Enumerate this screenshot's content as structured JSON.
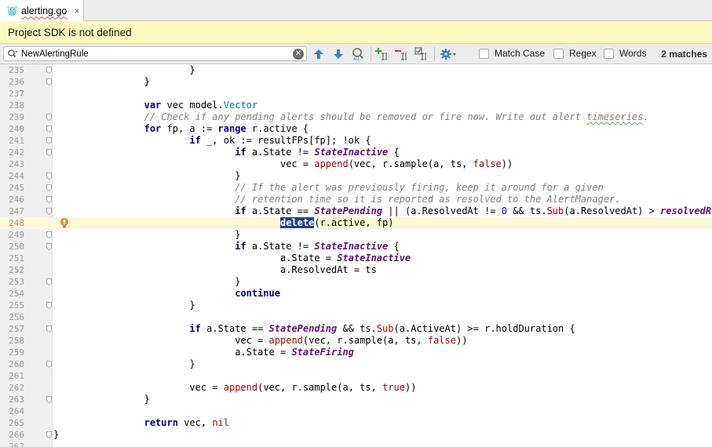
{
  "tab": {
    "filename": "alerting.go",
    "close_glyph": "×"
  },
  "banner": {
    "message": "Project SDK is not defined"
  },
  "search": {
    "query": "NewAlertingRule",
    "options": [
      {
        "label": "Match Case",
        "checked": false
      },
      {
        "label": "Regex",
        "checked": false
      },
      {
        "label": "Words",
        "checked": false
      }
    ],
    "match_count": "2 matches",
    "toolbar_icons": [
      "previous-occurrence-icon",
      "next-occurrence-icon",
      "find-all-icon",
      "add-occurrence-icon",
      "remove-occurrence-icon",
      "select-all-occurrences-icon",
      "settings-icon"
    ]
  },
  "colors": {
    "keyword": "#000080",
    "type": "#008080",
    "constant": "#660e7a",
    "builtin_function": "#aa0000",
    "number": "#0000ff",
    "comment": "#808080",
    "current_line": "#fcf8d8",
    "banner": "#fdf7c0",
    "selection": "#214283"
  },
  "editor": {
    "current_line": 248,
    "lines": [
      {
        "n": "235",
        "fold": true,
        "tokens": [
          {
            "t": "\t\t\t}",
            "c": ""
          }
        ]
      },
      {
        "n": "236",
        "fold": true,
        "tokens": [
          {
            "t": "\t\t}",
            "c": ""
          }
        ]
      },
      {
        "n": "237",
        "fold": false,
        "tokens": []
      },
      {
        "n": "238",
        "fold": false,
        "tokens": [
          {
            "t": "\t\t",
            "c": ""
          },
          {
            "t": "var",
            "c": "kw"
          },
          {
            "t": " vec model.",
            "c": ""
          },
          {
            "t": "Vector",
            "c": "typ"
          }
        ]
      },
      {
        "n": "239",
        "fold": true,
        "tokens": [
          {
            "t": "\t\t",
            "c": ""
          },
          {
            "t": "// Check if any pending alerts should be removed or fire now. Write out alert ",
            "c": "cmt"
          },
          {
            "t": "timeseries",
            "c": "cmt typo"
          },
          {
            "t": ".",
            "c": "cmt"
          }
        ]
      },
      {
        "n": "240",
        "fold": true,
        "tokens": [
          {
            "t": "\t\t",
            "c": ""
          },
          {
            "t": "for",
            "c": "kw"
          },
          {
            "t": " fp, a := ",
            "c": ""
          },
          {
            "t": "range",
            "c": "kw"
          },
          {
            "t": " r.active {",
            "c": ""
          }
        ]
      },
      {
        "n": "241",
        "fold": true,
        "tokens": [
          {
            "t": "\t\t\t",
            "c": ""
          },
          {
            "t": "if",
            "c": "kw"
          },
          {
            "t": " _, ok := resultFPs[fp]; !ok {",
            "c": ""
          }
        ]
      },
      {
        "n": "242",
        "fold": true,
        "tokens": [
          {
            "t": "\t\t\t\t",
            "c": ""
          },
          {
            "t": "if",
            "c": "kw"
          },
          {
            "t": " a.State != ",
            "c": ""
          },
          {
            "t": "StateInactive",
            "c": "cst"
          },
          {
            "t": " {",
            "c": ""
          }
        ]
      },
      {
        "n": "243",
        "fold": false,
        "tokens": [
          {
            "t": "\t\t\t\t\tvec = ",
            "c": ""
          },
          {
            "t": "append",
            "c": "fn"
          },
          {
            "t": "(vec, r.sample(a, ts, ",
            "c": ""
          },
          {
            "t": "false",
            "c": "fn"
          },
          {
            "t": "))",
            "c": ""
          }
        ]
      },
      {
        "n": "244",
        "fold": true,
        "tokens": [
          {
            "t": "\t\t\t\t}",
            "c": ""
          }
        ]
      },
      {
        "n": "245",
        "fold": true,
        "tokens": [
          {
            "t": "\t\t\t\t",
            "c": ""
          },
          {
            "t": "// If the alert was previously firing, keep it around for a given",
            "c": "cmt"
          }
        ]
      },
      {
        "n": "246",
        "fold": true,
        "tokens": [
          {
            "t": "\t\t\t\t",
            "c": ""
          },
          {
            "t": "// retention time so it is reported as resolved to the AlertManager.",
            "c": "cmt"
          }
        ]
      },
      {
        "n": "247",
        "fold": true,
        "tokens": [
          {
            "t": "\t\t\t\t",
            "c": ""
          },
          {
            "t": "if",
            "c": "kw"
          },
          {
            "t": " a.State == ",
            "c": ""
          },
          {
            "t": "StatePending",
            "c": "cst"
          },
          {
            "t": " || (a.ResolvedAt != ",
            "c": ""
          },
          {
            "t": "0",
            "c": "num"
          },
          {
            "t": " && ts.",
            "c": ""
          },
          {
            "t": "Sub",
            "c": "fn"
          },
          {
            "t": "(a.ResolvedAt) > ",
            "c": ""
          },
          {
            "t": "resolvedRetention",
            "c": "cst"
          },
          {
            "t": ") {",
            "c": ""
          }
        ]
      },
      {
        "n": "248",
        "fold": false,
        "bulb": true,
        "tokens": [
          {
            "t": "\t\t\t\t\t",
            "c": ""
          },
          {
            "t": "delete",
            "c": "kw hl"
          },
          {
            "t": "(r.active, fp)",
            "c": ""
          }
        ]
      },
      {
        "n": "249",
        "fold": true,
        "tokens": [
          {
            "t": "\t\t\t\t}",
            "c": ""
          }
        ]
      },
      {
        "n": "250",
        "fold": true,
        "tokens": [
          {
            "t": "\t\t\t\t",
            "c": ""
          },
          {
            "t": "if",
            "c": "kw"
          },
          {
            "t": " a.State != ",
            "c": ""
          },
          {
            "t": "StateInactive",
            "c": "cst"
          },
          {
            "t": " {",
            "c": ""
          }
        ]
      },
      {
        "n": "251",
        "fold": false,
        "tokens": [
          {
            "t": "\t\t\t\t\ta.State = ",
            "c": ""
          },
          {
            "t": "StateInactive",
            "c": "cst"
          }
        ]
      },
      {
        "n": "252",
        "fold": false,
        "tokens": [
          {
            "t": "\t\t\t\t\ta.ResolvedAt = ts",
            "c": ""
          }
        ]
      },
      {
        "n": "253",
        "fold": true,
        "tokens": [
          {
            "t": "\t\t\t\t}",
            "c": ""
          }
        ]
      },
      {
        "n": "254",
        "fold": false,
        "tokens": [
          {
            "t": "\t\t\t\t",
            "c": ""
          },
          {
            "t": "continue",
            "c": "kw"
          }
        ]
      },
      {
        "n": "255",
        "fold": true,
        "tokens": [
          {
            "t": "\t\t\t}",
            "c": ""
          }
        ]
      },
      {
        "n": "256",
        "fold": false,
        "tokens": []
      },
      {
        "n": "257",
        "fold": true,
        "tokens": [
          {
            "t": "\t\t\t",
            "c": ""
          },
          {
            "t": "if",
            "c": "kw"
          },
          {
            "t": " a.State == ",
            "c": ""
          },
          {
            "t": "StatePending",
            "c": "cst"
          },
          {
            "t": " && ts.",
            "c": ""
          },
          {
            "t": "Sub",
            "c": "fn"
          },
          {
            "t": "(a.ActiveAt) >= r.holdDuration {",
            "c": ""
          }
        ]
      },
      {
        "n": "258",
        "fold": false,
        "tokens": [
          {
            "t": "\t\t\t\tvec = ",
            "c": ""
          },
          {
            "t": "append",
            "c": "fn"
          },
          {
            "t": "(vec, r.sample(a, ts, ",
            "c": ""
          },
          {
            "t": "false",
            "c": "fn"
          },
          {
            "t": "))",
            "c": ""
          }
        ]
      },
      {
        "n": "259",
        "fold": false,
        "tokens": [
          {
            "t": "\t\t\t\ta.State = ",
            "c": ""
          },
          {
            "t": "StateFiring",
            "c": "cst"
          }
        ]
      },
      {
        "n": "260",
        "fold": true,
        "tokens": [
          {
            "t": "\t\t\t}",
            "c": ""
          }
        ]
      },
      {
        "n": "261",
        "fold": false,
        "tokens": []
      },
      {
        "n": "262",
        "fold": false,
        "tokens": [
          {
            "t": "\t\t\tvec = ",
            "c": ""
          },
          {
            "t": "append",
            "c": "fn"
          },
          {
            "t": "(vec, r.sample(a, ts, ",
            "c": ""
          },
          {
            "t": "true",
            "c": "fn"
          },
          {
            "t": "))",
            "c": ""
          }
        ]
      },
      {
        "n": "263",
        "fold": true,
        "tokens": [
          {
            "t": "\t\t}",
            "c": ""
          }
        ]
      },
      {
        "n": "264",
        "fold": false,
        "tokens": []
      },
      {
        "n": "265",
        "fold": false,
        "tokens": [
          {
            "t": "\t\t",
            "c": ""
          },
          {
            "t": "return",
            "c": "kw"
          },
          {
            "t": " vec, ",
            "c": ""
          },
          {
            "t": "nil",
            "c": "fn"
          }
        ]
      },
      {
        "n": "266",
        "fold": true,
        "tokens": [
          {
            "t": "}",
            "c": ""
          }
        ]
      },
      {
        "n": "267",
        "fold": false,
        "tokens": []
      }
    ]
  }
}
